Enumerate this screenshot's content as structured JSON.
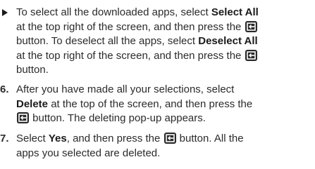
{
  "bullet": {
    "l1a": "To select all the downloaded apps, select ",
    "l1b": "Select All",
    "l2a": "at the top right of the screen, and then press the ",
    "l3a": "button. To deselect all the apps, select ",
    "l3b": "Deselect All",
    "l4a": "at the top right of the screen, and then press the ",
    "l5a": "button."
  },
  "step6": {
    "num": "6.",
    "l1a": "After you have made all your selections, select",
    "l2a": "Delete",
    "l2b": " at the top of the screen, and then press the",
    "l3b": " button. The deleting pop-up appears."
  },
  "step7": {
    "num": "7.",
    "l1a": "Select ",
    "l1b": "Yes",
    "l1c": ", and then press the ",
    "l1d": " button. All the",
    "l2a": "apps you selected are deleted."
  },
  "icon": "enter-button-icon"
}
